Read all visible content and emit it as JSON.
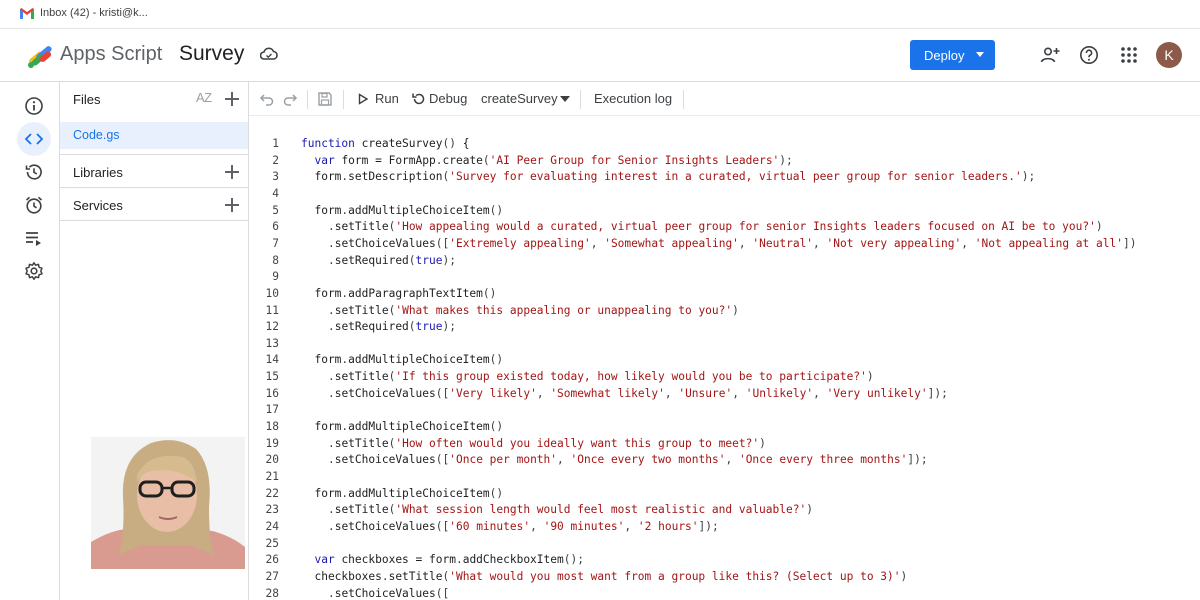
{
  "browser": {
    "tab_title": "Inbox (42) - kristi@k..."
  },
  "header": {
    "app_name": "Apps Script",
    "project_name": "Survey",
    "deploy_label": "Deploy",
    "avatar_letter": "K",
    "accent_color": "#1a73e8"
  },
  "rail": {
    "icons": [
      "info-icon",
      "code-icon",
      "history-icon",
      "alarm-icon",
      "executions-icon",
      "settings-icon"
    ]
  },
  "files_panel": {
    "title": "Files",
    "sort_label": "AZ",
    "files": [
      "Code.gs"
    ],
    "sections": [
      "Libraries",
      "Services"
    ]
  },
  "toolbar": {
    "run_label": "Run",
    "debug_label": "Debug",
    "function_name": "createSurvey",
    "exec_log_label": "Execution log"
  },
  "code": {
    "lines": [
      {
        "n": "1",
        "src": "function createSurvey() {"
      },
      {
        "n": "2",
        "src": "  var form = FormApp.create('AI Peer Group for Senior Insights Leaders');"
      },
      {
        "n": "3",
        "src": "  form.setDescription('Survey for evaluating interest in a curated, virtual peer group for senior leaders.');"
      },
      {
        "n": "4",
        "src": ""
      },
      {
        "n": "5",
        "src": "  form.addMultipleChoiceItem()"
      },
      {
        "n": "6",
        "src": "    .setTitle('How appealing would a curated, virtual peer group for senior Insights leaders focused on AI be to you?')"
      },
      {
        "n": "7",
        "src": "    .setChoiceValues(['Extremely appealing', 'Somewhat appealing', 'Neutral', 'Not very appealing', 'Not appealing at all'])"
      },
      {
        "n": "8",
        "src": "    .setRequired(true);"
      },
      {
        "n": "9",
        "src": ""
      },
      {
        "n": "10",
        "src": "  form.addParagraphTextItem()"
      },
      {
        "n": "11",
        "src": "    .setTitle('What makes this appealing or unappealing to you?')"
      },
      {
        "n": "12",
        "src": "    .setRequired(true);"
      },
      {
        "n": "13",
        "src": ""
      },
      {
        "n": "14",
        "src": "  form.addMultipleChoiceItem()"
      },
      {
        "n": "15",
        "src": "    .setTitle('If this group existed today, how likely would you be to participate?')"
      },
      {
        "n": "16",
        "src": "    .setChoiceValues(['Very likely', 'Somewhat likely', 'Unsure', 'Unlikely', 'Very unlikely']);"
      },
      {
        "n": "17",
        "src": ""
      },
      {
        "n": "18",
        "src": "  form.addMultipleChoiceItem()"
      },
      {
        "n": "19",
        "src": "    .setTitle('How often would you ideally want this group to meet?')"
      },
      {
        "n": "20",
        "src": "    .setChoiceValues(['Once per month', 'Once every two months', 'Once every three months']);"
      },
      {
        "n": "21",
        "src": ""
      },
      {
        "n": "22",
        "src": "  form.addMultipleChoiceItem()"
      },
      {
        "n": "23",
        "src": "    .setTitle('What session length would feel most realistic and valuable?')"
      },
      {
        "n": "24",
        "src": "    .setChoiceValues(['60 minutes', '90 minutes', '2 hours']);"
      },
      {
        "n": "25",
        "src": ""
      },
      {
        "n": "26",
        "src": "  var checkboxes = form.addCheckboxItem();"
      },
      {
        "n": "27",
        "src": "  checkboxes.setTitle('What would you most want from a group like this? (Select up to 3)')"
      },
      {
        "n": "28",
        "src": "    .setChoiceValues(["
      }
    ]
  }
}
